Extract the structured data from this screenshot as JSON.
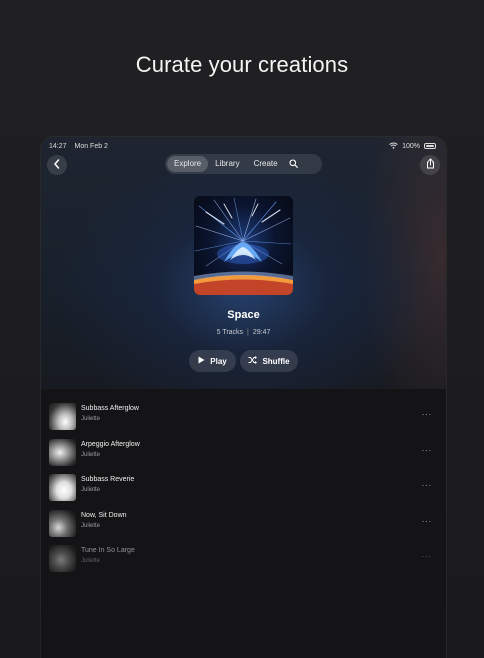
{
  "headline": "Curate your creations",
  "status": {
    "time": "14:27",
    "date": "Mon Feb 2",
    "battery": "100%"
  },
  "nav": {
    "tabs": [
      {
        "label": "Explore",
        "active": true
      },
      {
        "label": "Library",
        "active": false
      },
      {
        "label": "Create",
        "active": false
      }
    ]
  },
  "album": {
    "title": "Space",
    "track_count": "5 Tracks",
    "duration": "29:47",
    "separator": "|"
  },
  "actions": {
    "play_label": "Play",
    "shuffle_label": "Shuffle"
  },
  "tracks": [
    {
      "title": "Subbass Afterglow",
      "artist": "Juliette"
    },
    {
      "title": "Arpeggio Afterglow",
      "artist": "Juliette"
    },
    {
      "title": "Subbass Reverie",
      "artist": "Juliette"
    },
    {
      "title": "Now, Sit Down",
      "artist": "Juliette"
    },
    {
      "title": "Tune In So Large",
      "artist": "Juliette"
    }
  ],
  "more_glyph": "···",
  "icons": [
    "back-chevron-icon",
    "search-icon",
    "share-icon",
    "play-icon",
    "shuffle-icon",
    "more-icon",
    "wifi-icon",
    "battery-icon"
  ]
}
